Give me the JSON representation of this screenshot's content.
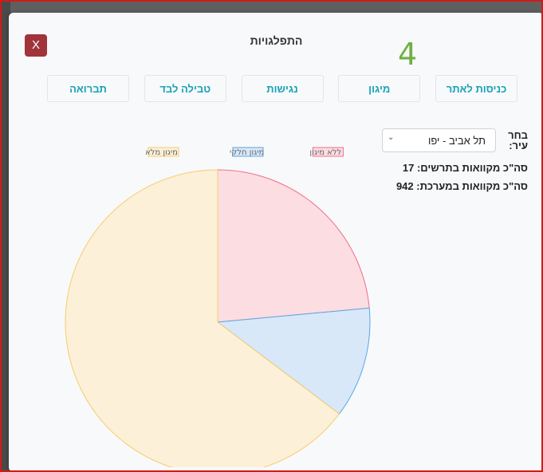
{
  "modal": {
    "close_label": "X",
    "title": "התפלגויות",
    "big_count": "4"
  },
  "tabs": [
    {
      "label": "כניסות לאתר"
    },
    {
      "label": "מיגון"
    },
    {
      "label": "נגישות"
    },
    {
      "label": "טבילה לבד"
    },
    {
      "label": "תברואה"
    }
  ],
  "filter": {
    "city_label": "בחר עיר:",
    "city_value": "תל אביב - יפו",
    "city_total": "סה\"כ מקוואות בתרשים: 17",
    "system_total": "סה\"כ מקוואות במערכת: 942"
  },
  "icons": {
    "close": "close-icon",
    "select": "chevron-down-icon"
  },
  "colors": {
    "close_button": "#a0343a",
    "count": "#6fb045",
    "tab_text": "#17a2b8"
  },
  "chart_data": {
    "type": "pie",
    "title": "",
    "legend_position": "top",
    "categories": [
      "ללא מיגון",
      "מיגון חלקי",
      "מיגון מלא"
    ],
    "values": [
      4,
      2,
      11
    ],
    "colors": [
      {
        "fill": "#fcdde2",
        "stroke": "#f06e8a"
      },
      {
        "fill": "#d8e8f9",
        "stroke": "#5aa7e2"
      },
      {
        "fill": "#fcf0d9",
        "stroke": "#f6cd6a"
      }
    ]
  }
}
